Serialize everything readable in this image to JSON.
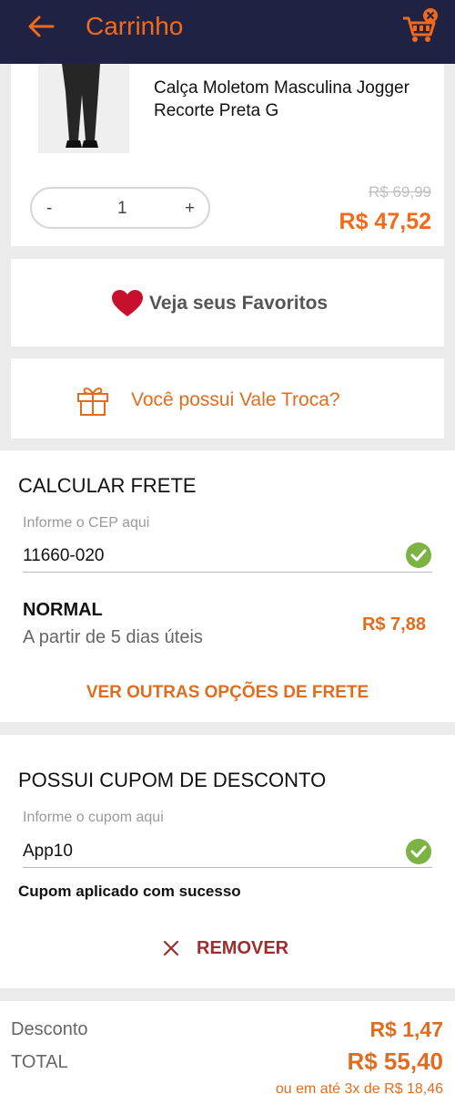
{
  "header": {
    "title": "Carrinho",
    "bg": "#1f2242",
    "accent": "#f26a1b",
    "back_icon": "arrow-left-icon",
    "cart_icon": "cart-remove-icon"
  },
  "product": {
    "name": "Calça Moletom Masculina Jogger Recorte Preta G",
    "quantity": "1",
    "minus": "-",
    "plus": "+",
    "old_price": "R$ 69,99",
    "price": "R$ 47,52"
  },
  "favorites": {
    "label": "Veja seus Favoritos",
    "icon": "heart-icon"
  },
  "vale_troca": {
    "label": "Você possui Vale Troca?",
    "icon": "gift-icon"
  },
  "frete": {
    "title": "CALCULAR FRETE",
    "placeholder": "Informe o CEP aqui",
    "value": "11660-020",
    "option_name": "NORMAL",
    "option_desc": "A partir de 5 dias úteis",
    "option_price": "R$ 7,88",
    "more_link": "VER OUTRAS OPÇÕES DE FRETE"
  },
  "cupom": {
    "title": "POSSUI CUPOM DE DESCONTO",
    "placeholder": "Informe o cupom aqui",
    "value": "App10",
    "success": "Cupom aplicado com sucesso",
    "remove_label": "REMOVER"
  },
  "totals": {
    "discount_label": "Desconto",
    "discount_value": "R$ 1,47",
    "total_label": "TOTAL",
    "total_value": "R$ 55,40",
    "installments": "ou em até 3x de R$ 18,46"
  }
}
